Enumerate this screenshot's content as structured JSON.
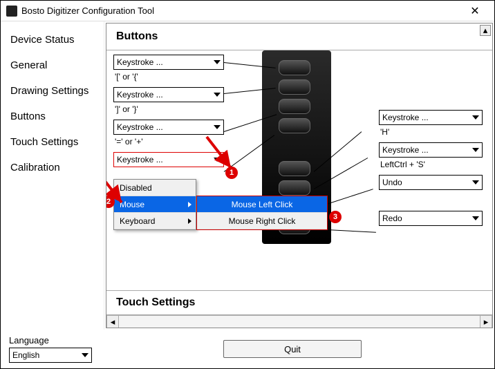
{
  "window": {
    "title": "Bosto Digitizer Configuration Tool"
  },
  "sidebar": {
    "items": [
      {
        "label": "Device Status"
      },
      {
        "label": "General"
      },
      {
        "label": "Drawing Settings"
      },
      {
        "label": "Buttons"
      },
      {
        "label": "Touch Settings"
      },
      {
        "label": "Calibration"
      }
    ]
  },
  "section1_title": "Buttons",
  "section2_title": "Touch Settings",
  "left": {
    "c0": {
      "value": "Keystroke ...",
      "hint": "'[' or '{'"
    },
    "c1": {
      "value": "Keystroke ...",
      "hint": "']' or '}'"
    },
    "c2": {
      "value": "Keystroke ...",
      "hint": "'=' or '+'"
    },
    "c3": {
      "value": "Keystroke ..."
    }
  },
  "right": {
    "c0": {
      "value": "Keystroke ...",
      "hint": "'H'"
    },
    "c1": {
      "value": "Keystroke ...",
      "hint": "LeftCtrl + 'S'"
    },
    "c2": {
      "value": "Undo"
    },
    "c3": {
      "value": "Redo"
    }
  },
  "popup": {
    "items": [
      {
        "label": "Disabled"
      },
      {
        "label": "Mouse"
      },
      {
        "label": "Keyboard"
      }
    ],
    "submenu": [
      {
        "label": "Mouse Left Click"
      },
      {
        "label": "Mouse Right Click"
      }
    ]
  },
  "markers": {
    "m1": "1",
    "m2": "2",
    "m3": "3"
  },
  "footer": {
    "language_label": "Language",
    "language_value": "English",
    "quit": "Quit"
  }
}
